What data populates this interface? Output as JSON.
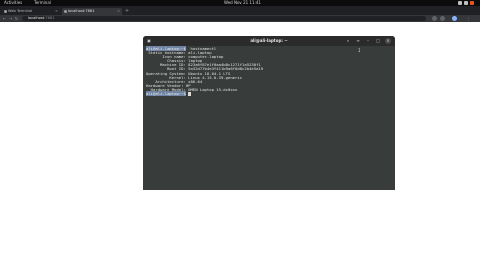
{
  "topbar": {
    "activities": "Activities",
    "app_menu": "Terminal",
    "clock": "Wed Nov 21  11:41"
  },
  "browser": {
    "tabs": [
      {
        "title": "Web Terminal"
      },
      {
        "title": "localhost:7681"
      }
    ],
    "url": {
      "host": "localhost",
      "port": ":7681"
    }
  },
  "terminal": {
    "title": "ali@ali-laptop: ~",
    "lines": [
      {
        "prompt": "ali@ali-laptop:~$",
        "selected": "",
        "rest": "  hostnamectl"
      },
      {
        "prompt": "",
        "selected": "",
        "rest": " Static hostname: ali-laptop"
      },
      {
        "prompt": "",
        "selected": "",
        "rest": "       Icon name: computer-laptop"
      },
      {
        "prompt": "",
        "selected": "",
        "rest": "         Chassis: laptop"
      },
      {
        "prompt": "",
        "selected": "",
        "rest": "      Machine ID: 823a6f87e1f0aa4b8c1271f1a5230f1"
      },
      {
        "prompt": "",
        "selected": "",
        "rest": "         Boot ID: 5a32d77b4e3f411b9a6f0d8c2b4e5a19"
      },
      {
        "prompt": "",
        "selected": "",
        "rest": "Operating System: Ubuntu 18.04.1 LTS"
      },
      {
        "prompt": "",
        "selected": "",
        "rest": "          Kernel: Linux 4.15.0-39-generic"
      },
      {
        "prompt": "",
        "selected": "",
        "rest": "    Architecture: x86-64"
      },
      {
        "prompt": "",
        "selected": "",
        "rest": "Hardware Vendor: HP"
      },
      {
        "prompt": "",
        "selected": "",
        "rest": "  Hardware Model: OMEN Laptop 15-dc0xxx"
      },
      {
        "prompt": "ali@ali-laptop:~$",
        "selected": "",
        "rest": " "
      }
    ]
  }
}
